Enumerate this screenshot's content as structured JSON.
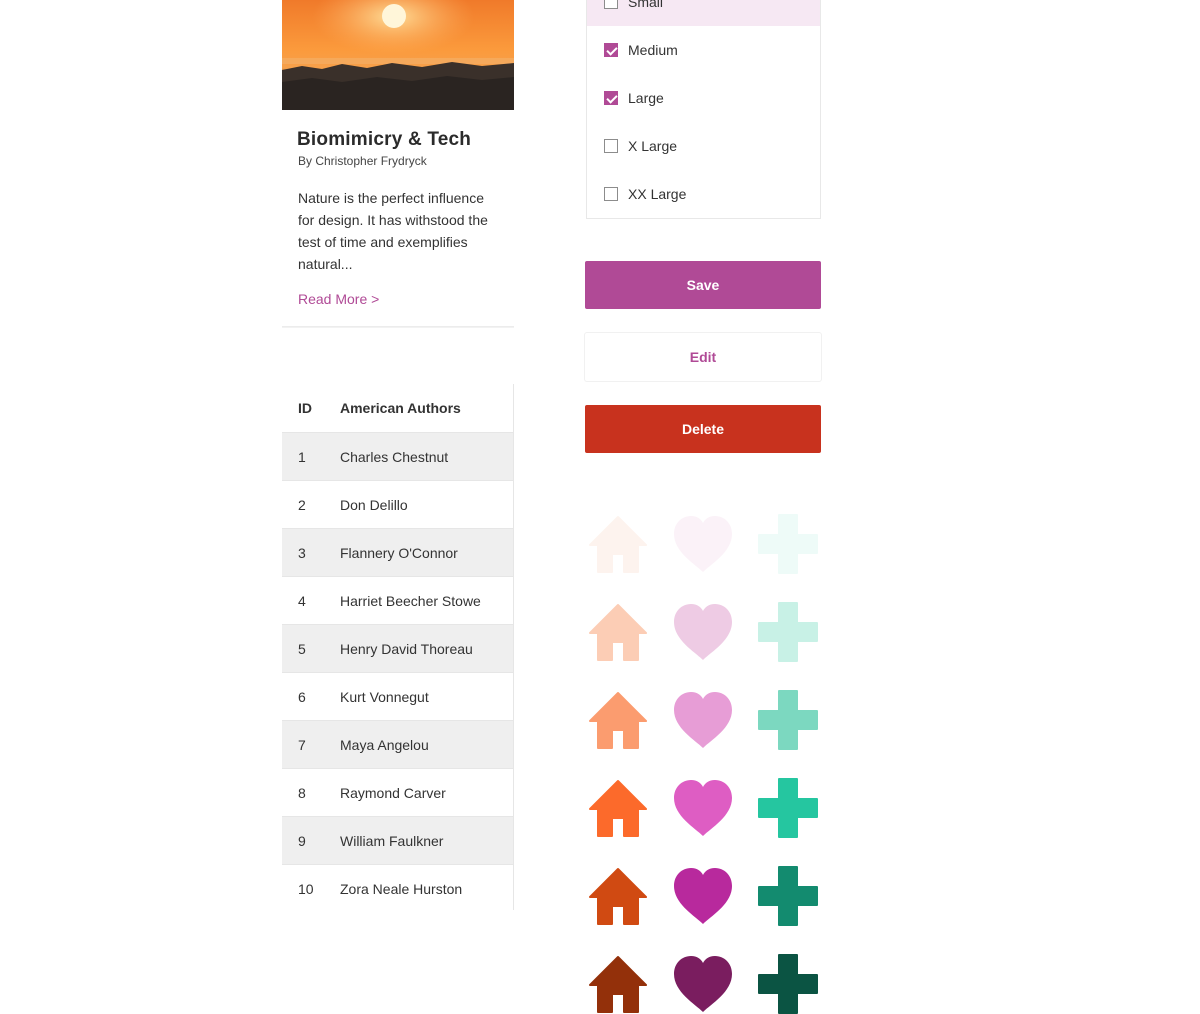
{
  "card": {
    "title": "Biomimicry & Tech",
    "author": "By Christopher Frydryck",
    "body": "Nature is the perfect influence for design. It has withstood the test of time and exemplifies natural...",
    "link": "Read More >"
  },
  "table": {
    "headers": [
      "ID",
      "American Authors"
    ],
    "rows": [
      [
        "1",
        "Charles Chestnut"
      ],
      [
        "2",
        "Don Delillo"
      ],
      [
        "3",
        "Flannery O'Connor"
      ],
      [
        "4",
        "Harriet Beecher Stowe"
      ],
      [
        "5",
        "Henry David Thoreau"
      ],
      [
        "6",
        "Kurt Vonnegut"
      ],
      [
        "7",
        "Maya Angelou"
      ],
      [
        "8",
        "Raymond Carver"
      ],
      [
        "9",
        "William Faulkner"
      ],
      [
        "10",
        "Zora Neale Hurston"
      ]
    ]
  },
  "sizes": {
    "options": [
      {
        "label": "Small",
        "checked": false
      },
      {
        "label": "Medium",
        "checked": true
      },
      {
        "label": "Large",
        "checked": true
      },
      {
        "label": "X Large",
        "checked": false
      },
      {
        "label": "XX Large",
        "checked": false
      }
    ]
  },
  "buttons": {
    "save": "Save",
    "edit": "Edit",
    "delete": "Delete"
  },
  "colors": {
    "accent": "#b04a96",
    "danger": "#c8321e",
    "house_shades": [
      "#fdf3ee",
      "#fccdb5",
      "#fb9c6f",
      "#fc6a2b",
      "#d04a12",
      "#93300a"
    ],
    "heart_shades": [
      "#fbf2f8",
      "#eecbe4",
      "#e79dd6",
      "#de5dc3",
      "#b8299d",
      "#7a1d5f"
    ],
    "plus_shades": [
      "#eefbf8",
      "#c8f1e6",
      "#7cd8c0",
      "#25c6a0",
      "#138b6f",
      "#0b5443"
    ]
  },
  "icons": [
    "house-icon",
    "heart-icon",
    "plus-icon"
  ]
}
